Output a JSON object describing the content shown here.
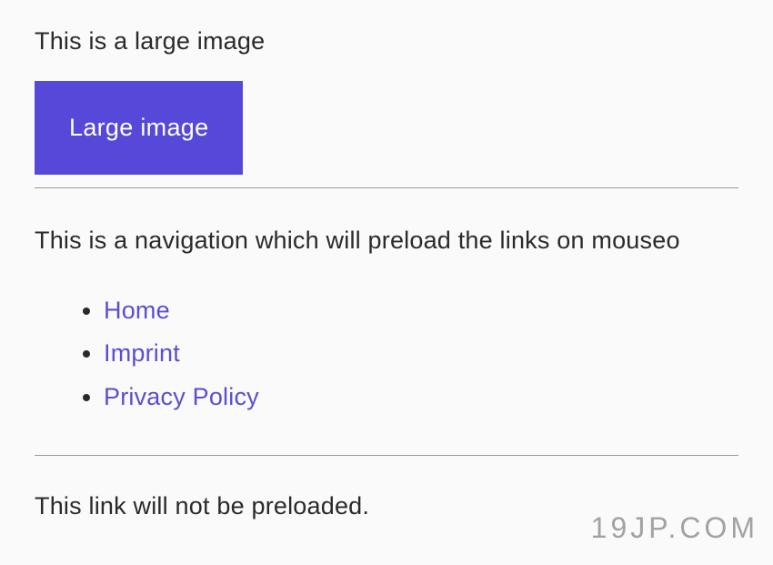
{
  "image_section": {
    "intro": "This is a large image",
    "box_label": "Large image"
  },
  "nav_section": {
    "intro": "This is a navigation which will preload the links on mouseo",
    "items": [
      {
        "label": "Home"
      },
      {
        "label": "Imprint"
      },
      {
        "label": "Privacy Policy"
      }
    ]
  },
  "no_preload_section": {
    "text": "This link will not be preloaded."
  },
  "watermark": "19JP.COM"
}
